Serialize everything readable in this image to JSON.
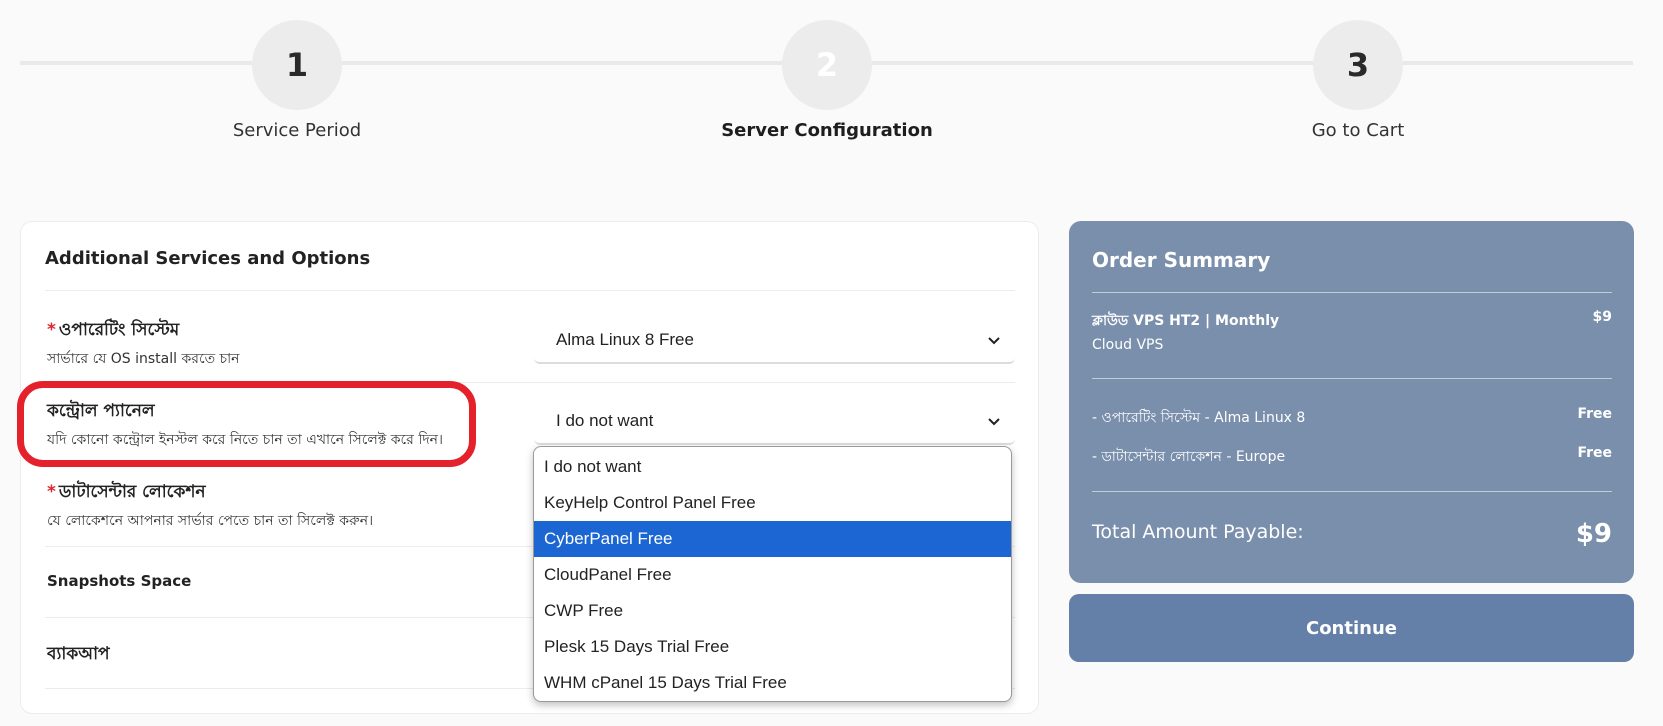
{
  "stepper": {
    "steps": [
      {
        "number": "1",
        "label": "Service Period"
      },
      {
        "number": "2",
        "label": "Server Configuration"
      },
      {
        "number": "3",
        "label": "Go to Cart"
      }
    ]
  },
  "panel": {
    "title": "Additional Services and Options",
    "rows": [
      {
        "required": "*",
        "label": "ওপারেটিং সিস্টেম",
        "desc": "সার্ভারে যে OS install করতে চান",
        "value": "Alma Linux 8 Free"
      },
      {
        "required": "",
        "label": "কন্ট্রোল প্যানেল",
        "desc": "যদি কোনো কন্ট্রোল ইনস্টল করে নিতে চান তা এখানে সিলেক্ট করে দিন।",
        "value": "I do not want"
      },
      {
        "required": "*",
        "label": "ডাটাসেন্টার লোকেশন",
        "desc": "যে লোকেশনে আপনার সার্ভার পেতে চান তা সিলেক্ট করুন।"
      },
      {
        "label": "Snapshots Space"
      },
      {
        "label": "ব্যাকআপ"
      }
    ]
  },
  "dropdown": {
    "options": [
      "I do not want",
      "KeyHelp Control Panel Free",
      "CyberPanel Free",
      "CloudPanel Free",
      "CWP Free",
      "Plesk 15 Days Trial Free",
      "WHM cPanel 15 Days Trial Free"
    ],
    "selected_index": 2
  },
  "summary": {
    "title": "Order Summary",
    "product": "ক্লাউড VPS HT2 | Monthly",
    "product_price": "$9",
    "product_sub": "Cloud VPS",
    "items": [
      {
        "label": "- ওপারেটিং সিস্টেম - Alma Linux 8",
        "price": "Free"
      },
      {
        "label": "- ডাটাসেন্টার লোকেশন - Europe",
        "price": "Free"
      }
    ],
    "total_label": "Total Amount Payable:",
    "total_value": "$9"
  },
  "continue_label": "Continue",
  "colors": {
    "summary_bg": "#7a8fab",
    "continue_bg": "#6480a8",
    "selected_option": "#1b66d3",
    "highlight": "#e3222b"
  }
}
